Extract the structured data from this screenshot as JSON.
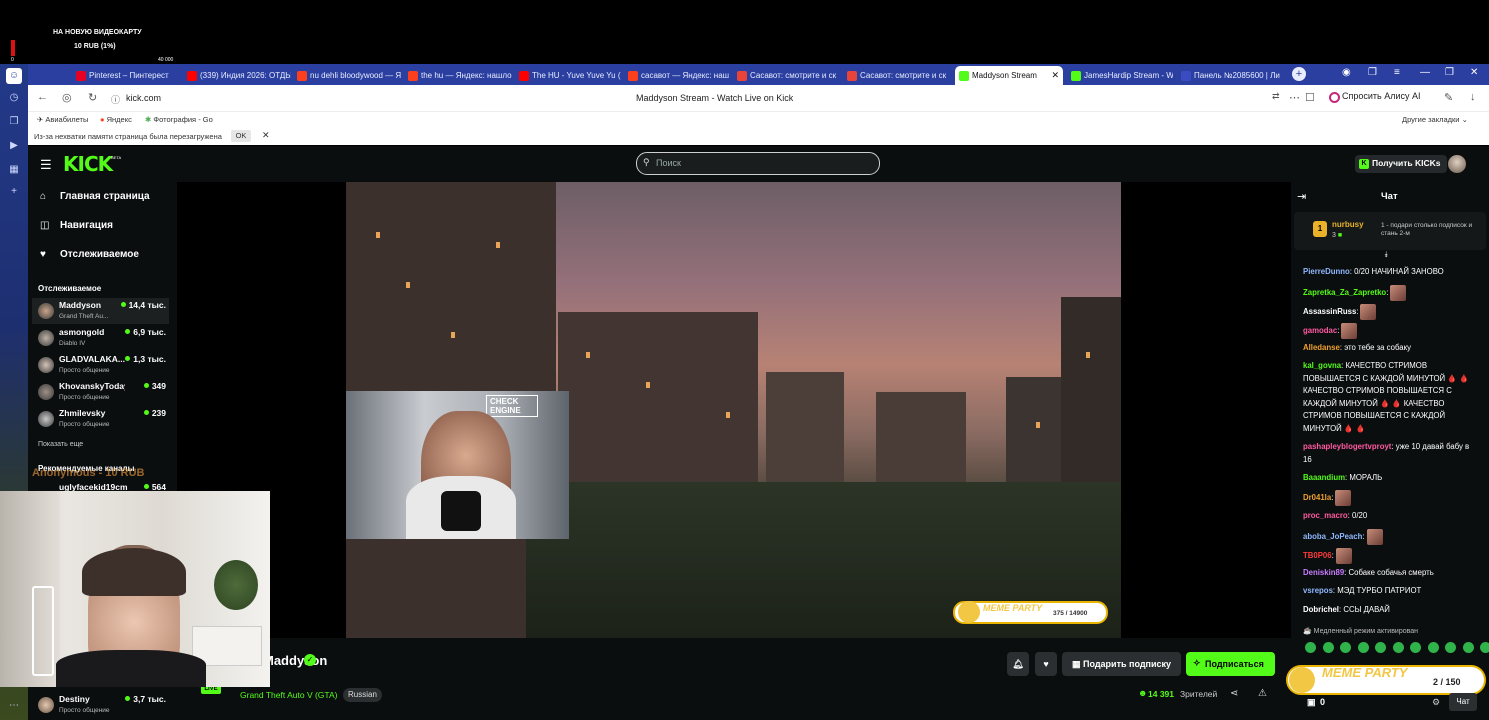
{
  "overlay": {
    "donate_title": "НА НОВУЮ ВИДЕОКАРТУ",
    "donate_amount": "10 RUB (1%)",
    "donate_min": "0",
    "donate_max": "40 000",
    "anon_text": "Anonymous - 10 RUB"
  },
  "tabs": [
    {
      "label": "Pinterest – Пинтерест",
      "color": "#e60023"
    },
    {
      "label": "(339) Индия 2026: ОТДЫ",
      "color": "#ff0000"
    },
    {
      "label": "nu dehli bloodywood — Я",
      "color": "#fc3f1d"
    },
    {
      "label": "the hu — Яндекс: нашло",
      "color": "#fc3f1d"
    },
    {
      "label": "The HU - Yuve Yuve Yu (",
      "color": "#ff0000"
    },
    {
      "label": "сасавот — Яндекс: наш",
      "color": "#fc3f1d"
    },
    {
      "label": "Сасавот: смотрите и ск",
      "color": "#e8443a"
    },
    {
      "label": "Сасавот: смотрите и ск",
      "color": "#e8443a"
    },
    {
      "label": "Maddyson Stream",
      "color": "#53fc18"
    },
    {
      "label": "JamesHardip Stream - W",
      "color": "#53fc18"
    },
    {
      "label": "Панель №2085600 | Ли",
      "color": "#3b4cc0"
    }
  ],
  "address": {
    "url": "kick.com",
    "page_title": "Maddyson Stream - Watch Live on Kick",
    "alice": "Спросить Алису AI"
  },
  "bookmarks": [
    "Авиабилеты",
    "Яндекс",
    "Фотография - Go"
  ],
  "bookmarks_other": "Другие закладки",
  "notice": {
    "text": "Из-за нехватки памяти страница была перезагружена",
    "ok": "OK"
  },
  "header": {
    "logo": "KICK",
    "beta": "BETA",
    "search_placeholder": "Поиск",
    "get_kicks": "Получить KICKs"
  },
  "nav": {
    "home": "Главная страница",
    "browse": "Навигация",
    "following": "Отслеживаемое",
    "followed_title": "Отслеживаемое",
    "show_more": "Показать еще",
    "recommended_title": "Рекомендуемые каналы"
  },
  "channels": [
    {
      "name": "Maddyson",
      "game": "Grand Theft Au...",
      "viewers": "14,4 тыс."
    },
    {
      "name": "asmongold",
      "game": "Diablo IV",
      "viewers": "6,9 тыс."
    },
    {
      "name": "GLADVALAKA...",
      "game": "Просто общение",
      "viewers": "1,3 тыс."
    },
    {
      "name": "KhovanskyToday",
      "game": "Просто общение",
      "viewers": "349"
    },
    {
      "name": "Zhmilevsky",
      "game": "Просто общение",
      "viewers": "239"
    }
  ],
  "recommended": [
    {
      "name": "uglyfacekid19cm",
      "viewers": "564"
    },
    {
      "name": "Destiny",
      "game": "Просто общение",
      "viewers": "3,7 тыс."
    }
  ],
  "video": {
    "facecam_text": "CHECK ENGINE",
    "meme_badge": "MEME PARTY",
    "meme_count": "375 / 14900"
  },
  "stream": {
    "name": "Maddyson",
    "sub": "Grand Theft Auto V (GTA)",
    "language": "Russian",
    "live": "LIVE",
    "gift_sub": "Подарить подписку",
    "subscribe": "Подписаться",
    "viewers": "14 391",
    "viewers_label": "Зрителей"
  },
  "chat": {
    "title": "Чат",
    "pinned_user": "nurbusy",
    "pinned_count": "3",
    "pinned_rank": "1",
    "pinned_text": "1 - подари столько подписок и стань 2-м",
    "messages": [
      {
        "user": "PierreDunno",
        "color": "#8fb8ff",
        "text": "0/20 НАЧИНАЙ ЗАНОВО"
      },
      {
        "user": "Zapretka_Za_Zapretko",
        "color": "#53fc18",
        "text": ""
      },
      {
        "user": "AssassinRuss",
        "color": "#ffffff",
        "text": ""
      },
      {
        "user": "gamodac",
        "color": "#ff5aa0",
        "text": ""
      },
      {
        "user": "Alledanse",
        "color": "#f0a030",
        "text": "это тебе за собаку"
      },
      {
        "user": "kal_govna",
        "color": "#53fc18",
        "text": "КАЧЕСТВО СТРИМОВ ПОВЫШАЕТСЯ С КАЖДОЙ МИНУТОЙ 🩸 🩸 КАЧЕСТВО СТРИМОВ ПОВЫШАЕТСЯ С КАЖДОЙ МИНУТОЙ 🩸 🩸 КАЧЕСТВО СТРИМОВ ПОВЫШАЕТСЯ С КАЖДОЙ МИНУТОЙ 🩸 🩸"
      },
      {
        "user": "pashapleyblogertvproyt",
        "color": "#ff5aa0",
        "text": "уже 10 давай бабу в 16"
      },
      {
        "user": "Baaandium",
        "color": "#53fc18",
        "text": "МОРАЛЬ"
      },
      {
        "user": "Dr041la",
        "color": "#f0a030",
        "text": ""
      },
      {
        "user": "proc_macro",
        "color": "#ff5aa0",
        "text": "0/20"
      },
      {
        "user": "aboba_JoPeach",
        "color": "#8fb8ff",
        "text": ""
      },
      {
        "user": "TB0P06",
        "color": "#ff3b3b",
        "text": ""
      },
      {
        "user": "Deniskin89",
        "color": "#c77dff",
        "text": "Собаке собачья смерть"
      },
      {
        "user": "vsrepos",
        "color": "#8fb8ff",
        "text": "МЭД ТУРБО ПАТРИОТ"
      },
      {
        "user": "Dobrichel",
        "color": "#ffffff",
        "text": "ССЫ ДАВАЙ"
      }
    ],
    "slow_mode": "Медленный режим активирован",
    "meme_badge": "MEME PARTY",
    "meme_count": "2 / 150",
    "bottom_count": "0",
    "send": "Чат"
  },
  "colors": {
    "kick_green": "#53fc18",
    "browser_blue": "#2a3fa0",
    "kick_bg": "#0b0e0f"
  }
}
